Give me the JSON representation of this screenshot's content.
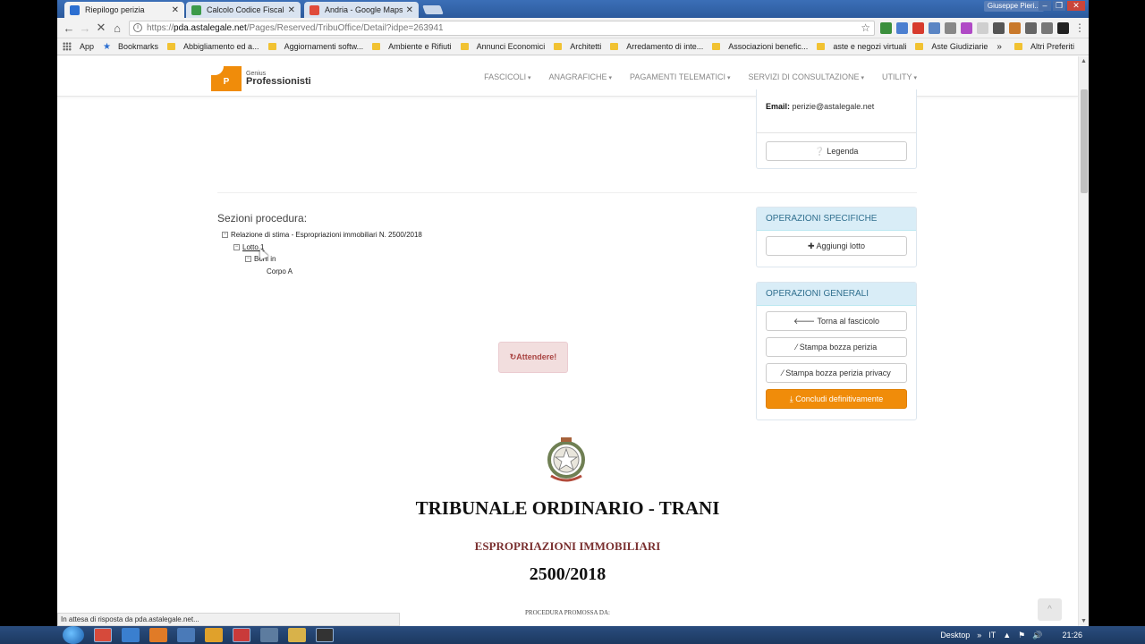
{
  "browser": {
    "tabs": [
      {
        "title": "Riepilogo perizia",
        "active": true,
        "icon_color": "#2c6fd1"
      },
      {
        "title": "Calcolo Codice Fiscale",
        "active": false,
        "icon_color": "#3c9a4a"
      },
      {
        "title": "Andria - Google Maps",
        "active": false,
        "icon_color": "#e04b3a"
      }
    ],
    "user": "Giuseppe Pieri...",
    "url": {
      "protocol": "https://",
      "host": "pda.astalegale.net",
      "path": "/Pages/Reserved/TribuOffice/Detail?idpe=263941"
    },
    "bookmarks": [
      {
        "label": "App",
        "type": "apps"
      },
      {
        "label": "Bookmarks",
        "type": "star"
      },
      {
        "label": "Abbigliamento ed a...",
        "type": "folder"
      },
      {
        "label": "Aggiornamenti softw...",
        "type": "folder"
      },
      {
        "label": "Ambiente e Rifiuti",
        "type": "folder"
      },
      {
        "label": "Annunci Economici",
        "type": "folder"
      },
      {
        "label": "Architetti",
        "type": "folder"
      },
      {
        "label": "Arredamento di inte...",
        "type": "folder"
      },
      {
        "label": "Associazioni benefic...",
        "type": "folder"
      },
      {
        "label": "aste e negozi virtuali",
        "type": "folder"
      },
      {
        "label": "Aste Giudiziarie",
        "type": "folder"
      }
    ],
    "bookmarks_more": "»",
    "other_bookmarks": "Altri Preferiti",
    "status": "In attesa di risposta da pda.astalegale.net..."
  },
  "site": {
    "logo_small": "Genius",
    "logo_big": "Professionisti",
    "logo_letter": "P",
    "menu": [
      "FASCICOLI",
      "ANAGRAFICHE",
      "PAGAMENTI TELEMATICI",
      "SERVIZI DI CONSULTAZIONE",
      "UTILITY"
    ]
  },
  "contact": {
    "email_label": "Email:",
    "email_value": "perizie@astalegale.net",
    "legend_button": "Legenda"
  },
  "sections": {
    "title": "Sezioni procedura:",
    "tree": {
      "root": "Relazione di stima - Espropriazioni immobiliari N. 2500/2018",
      "lot": "Lotto 1",
      "beni": "Beni in",
      "corpo": "Corpo A"
    }
  },
  "specific_ops": {
    "title": "OPERAZIONI SPECIFICHE",
    "add_lot": "Aggiungi lotto"
  },
  "general_ops": {
    "title": "OPERAZIONI GENERALI",
    "back": "Torna al fascicolo",
    "print_draft": "Stampa bozza perizia",
    "print_privacy": "Stampa bozza perizia privacy",
    "finalize": "Concludi definitivamente"
  },
  "loading": "Attendere!",
  "document": {
    "court": "TRIBUNALE ORDINARIO - TRANI",
    "type": "ESPROPRIAZIONI IMMOBILIARI",
    "number": "2500/2018",
    "promoted_by": "PROCEDURA PROMOSSA DA:"
  },
  "taskbar": {
    "desktop": "Desktop",
    "lang": "IT",
    "time": "21:26"
  },
  "colors": {
    "accent_orange": "#f08c0a",
    "panel_head": "#d9edf7",
    "wait_bg": "#f2dede"
  }
}
